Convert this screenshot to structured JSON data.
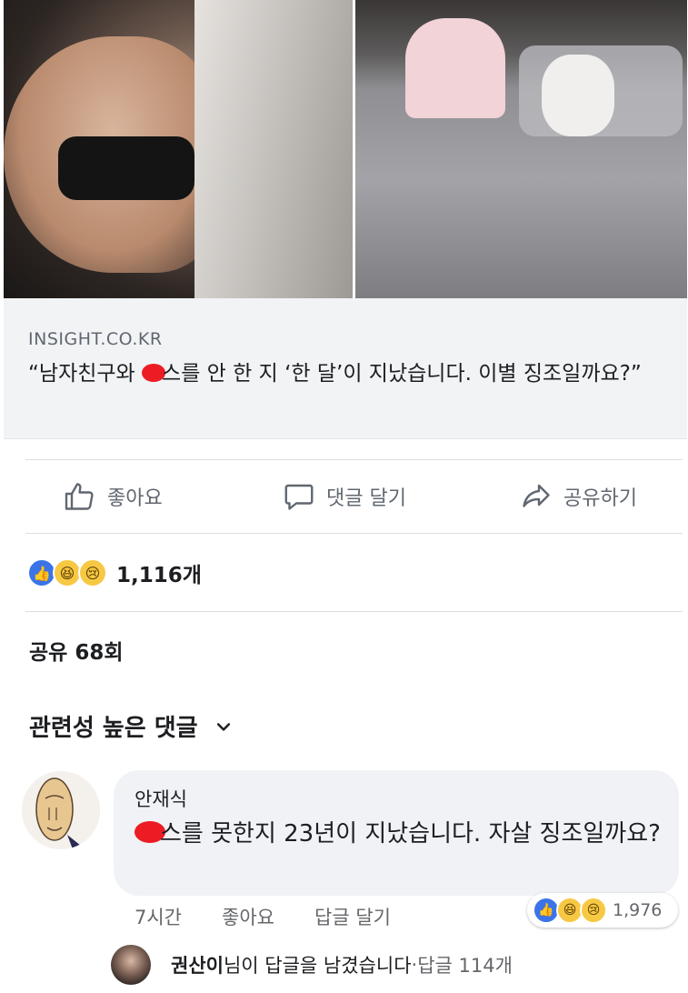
{
  "link_preview": {
    "domain": "INSIGHT.CO.KR",
    "title_prefix": "“남자친구와 ",
    "title_rest": "스를 안 한 지 ‘한 달’이 지났습니다. 이별 징조일까요?”"
  },
  "actions": {
    "like_label": "좋아요",
    "comment_label": "댓글 달기",
    "share_label": "공유하기"
  },
  "reactions": {
    "icons": [
      "like-icon",
      "haha-icon",
      "sad-icon"
    ],
    "count": "1,116개"
  },
  "shares": {
    "label": "공유 68회"
  },
  "comments": {
    "sort_label": "관련성 높은 댓글",
    "items": [
      {
        "author": "안재식",
        "text_rest": "스를 못한지 23년이 지났습니다. 자살 징조일까요?",
        "time": "7시간",
        "like_label": "좋아요",
        "reply_label": "답글 달기",
        "reaction_count": "1,976"
      }
    ]
  },
  "replies_summary": {
    "name": "권산이",
    "text": "님이 답글을 남겼습니다",
    "separator": " · ",
    "count_label": "답글 114개"
  },
  "colors": {
    "like_blue": "#3b74e8",
    "redaction_red": "#ec1c24",
    "meta_gray": "#65676b"
  }
}
